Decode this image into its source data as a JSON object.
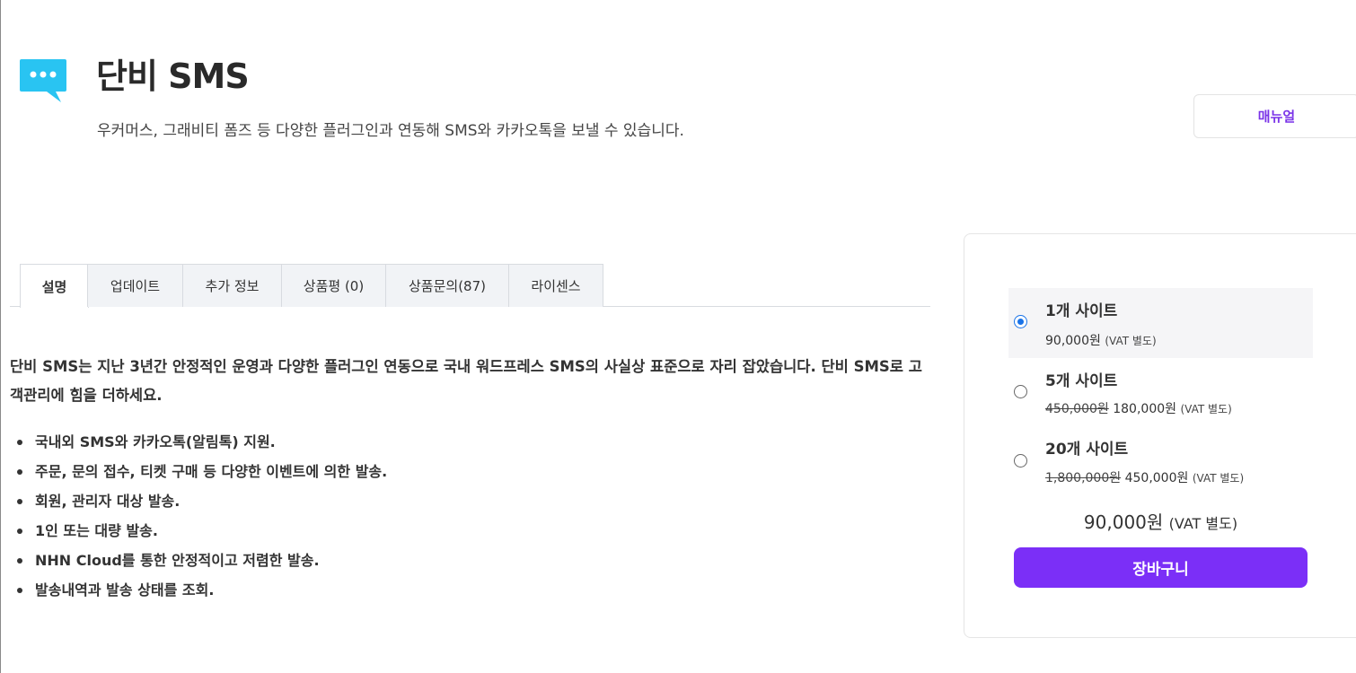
{
  "product": {
    "title": "단비 SMS",
    "description": "우커머스, 그래비티 폼즈 등 다양한 플러그인과 연동해 SMS와 카카오톡을 보낼 수 있습니다.",
    "icon": "chat-bubble-icon",
    "icon_color": "#29c4f2"
  },
  "actions": {
    "manual_label": "매뉴얼"
  },
  "tabs": [
    {
      "label": "설명",
      "active": true
    },
    {
      "label": "업데이트",
      "active": false
    },
    {
      "label": "추가 정보",
      "active": false
    },
    {
      "label": "상품평 (0)",
      "active": false
    },
    {
      "label": "상품문의(87)",
      "active": false
    },
    {
      "label": "라이센스",
      "active": false
    }
  ],
  "content": {
    "intro": "단비 SMS는 지난 3년간 안정적인 운영과 다양한 플러그인 연동으로 국내 워드프레스 SMS의 사실상 표준으로 자리 잡았습니다. 단비 SMS로 고객관리에 힘을 더하세요.",
    "features": [
      "국내외 SMS와 카카오톡(알림톡) 지원.",
      "주문, 문의 접수, 티켓 구매 등 다양한 이벤트에 의한 발송.",
      "회원, 관리자 대상 발송.",
      "1인 또는 대량 발송.",
      "NHN Cloud를 통한 안정적이고 저렴한 발송.",
      "발송내역과 발송 상태를 조회."
    ]
  },
  "pricing": {
    "options": [
      {
        "name": "1개 사이트",
        "original_price": "",
        "price": "90,000원",
        "vat": "(VAT 별도)",
        "selected": true
      },
      {
        "name": "5개 사이트",
        "original_price": "450,000원",
        "price": "180,000원",
        "vat": "(VAT 별도)",
        "selected": false
      },
      {
        "name": "20개 사이트",
        "original_price": "1,800,000원",
        "price": "450,000원",
        "vat": "(VAT 별도)",
        "selected": false
      }
    ],
    "total_price": "90,000원",
    "total_vat": "(VAT 별도)",
    "cart_label": "장바구니",
    "accent_color": "#7b2ff7"
  }
}
